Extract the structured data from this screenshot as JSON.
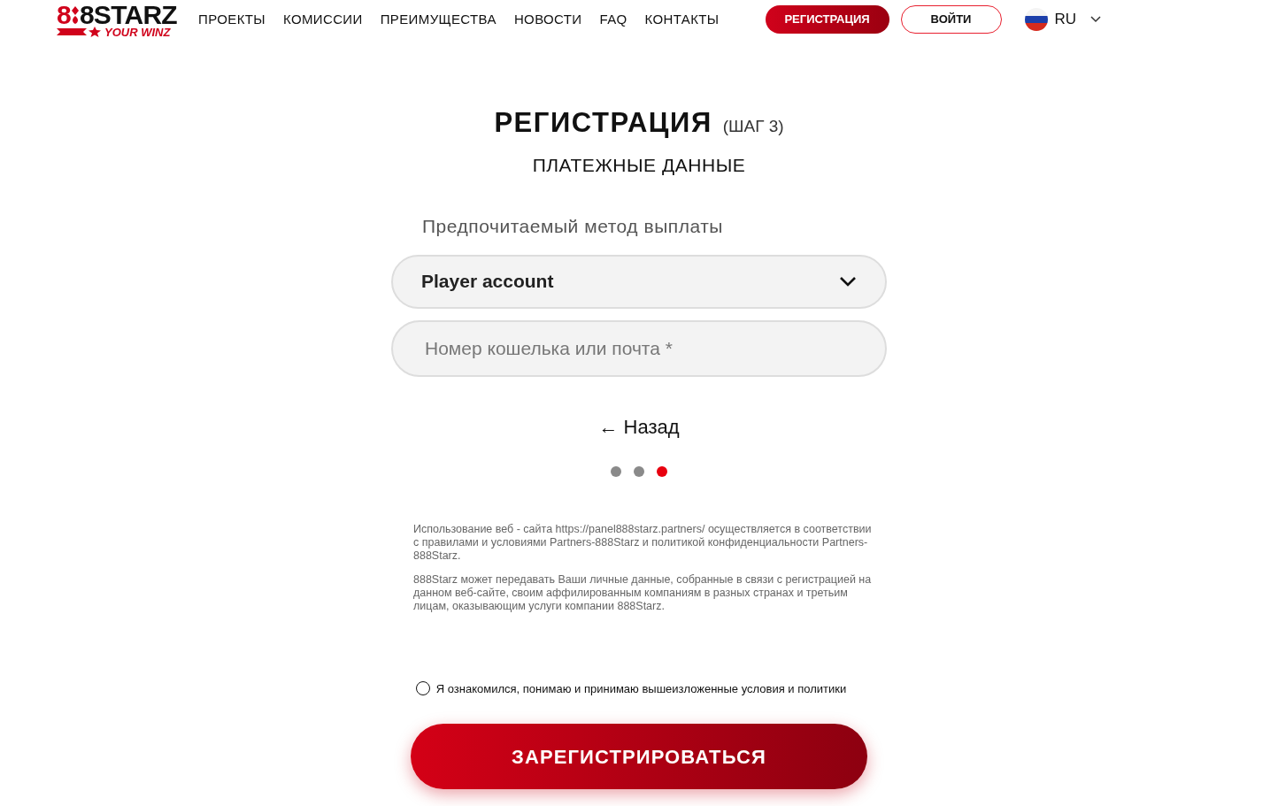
{
  "header": {
    "logo": {
      "digit": "8",
      "word": "8STARZ",
      "tagline": "YOUR WINZ"
    },
    "nav": [
      "ПРОЕКТЫ",
      "КОМИССИИ",
      "ПРЕИМУЩЕСТВА",
      "НОВОСТИ",
      "FAQ",
      "КОНТАКТЫ"
    ],
    "register_button": "РЕГИСТРАЦИЯ",
    "login_button": "ВОЙТИ",
    "language": "RU"
  },
  "title": "РЕГИСТРАЦИЯ",
  "step": "(ШАГ 3)",
  "subtitle": "ПЛАТЕЖНЫЕ ДАННЫЕ",
  "payout_label": "Предпочитаемый метод выплаты",
  "payout_select": {
    "value": "Player account"
  },
  "wallet_field": {
    "placeholder": "Номер кошелька или почта *"
  },
  "back_link": "← Назад",
  "steps": [
    {
      "selected": false
    },
    {
      "selected": false
    },
    {
      "selected": true
    }
  ],
  "legal": [
    "Использование веб - сайта https://panel888starz.partners/ осуществляется в соответствии с правилами и условиями Partners-888Starz и политикой конфиденциальности Partners-888Starz.",
    "888Starz может передавать Ваши личные данные, собранные в связи с регистрацией на данном веб-сайте, своим аффилированным компаниям в разных странах и третьим лицам, оказывающим услуги компании 888Starz."
  ],
  "consent": {
    "label": "Я ознакомился, понимаю и принимаю вышеизложенные условия и политики",
    "checked": false
  },
  "submit_button": "ЗАРЕГИСТРИРОВАТЬСЯ"
}
